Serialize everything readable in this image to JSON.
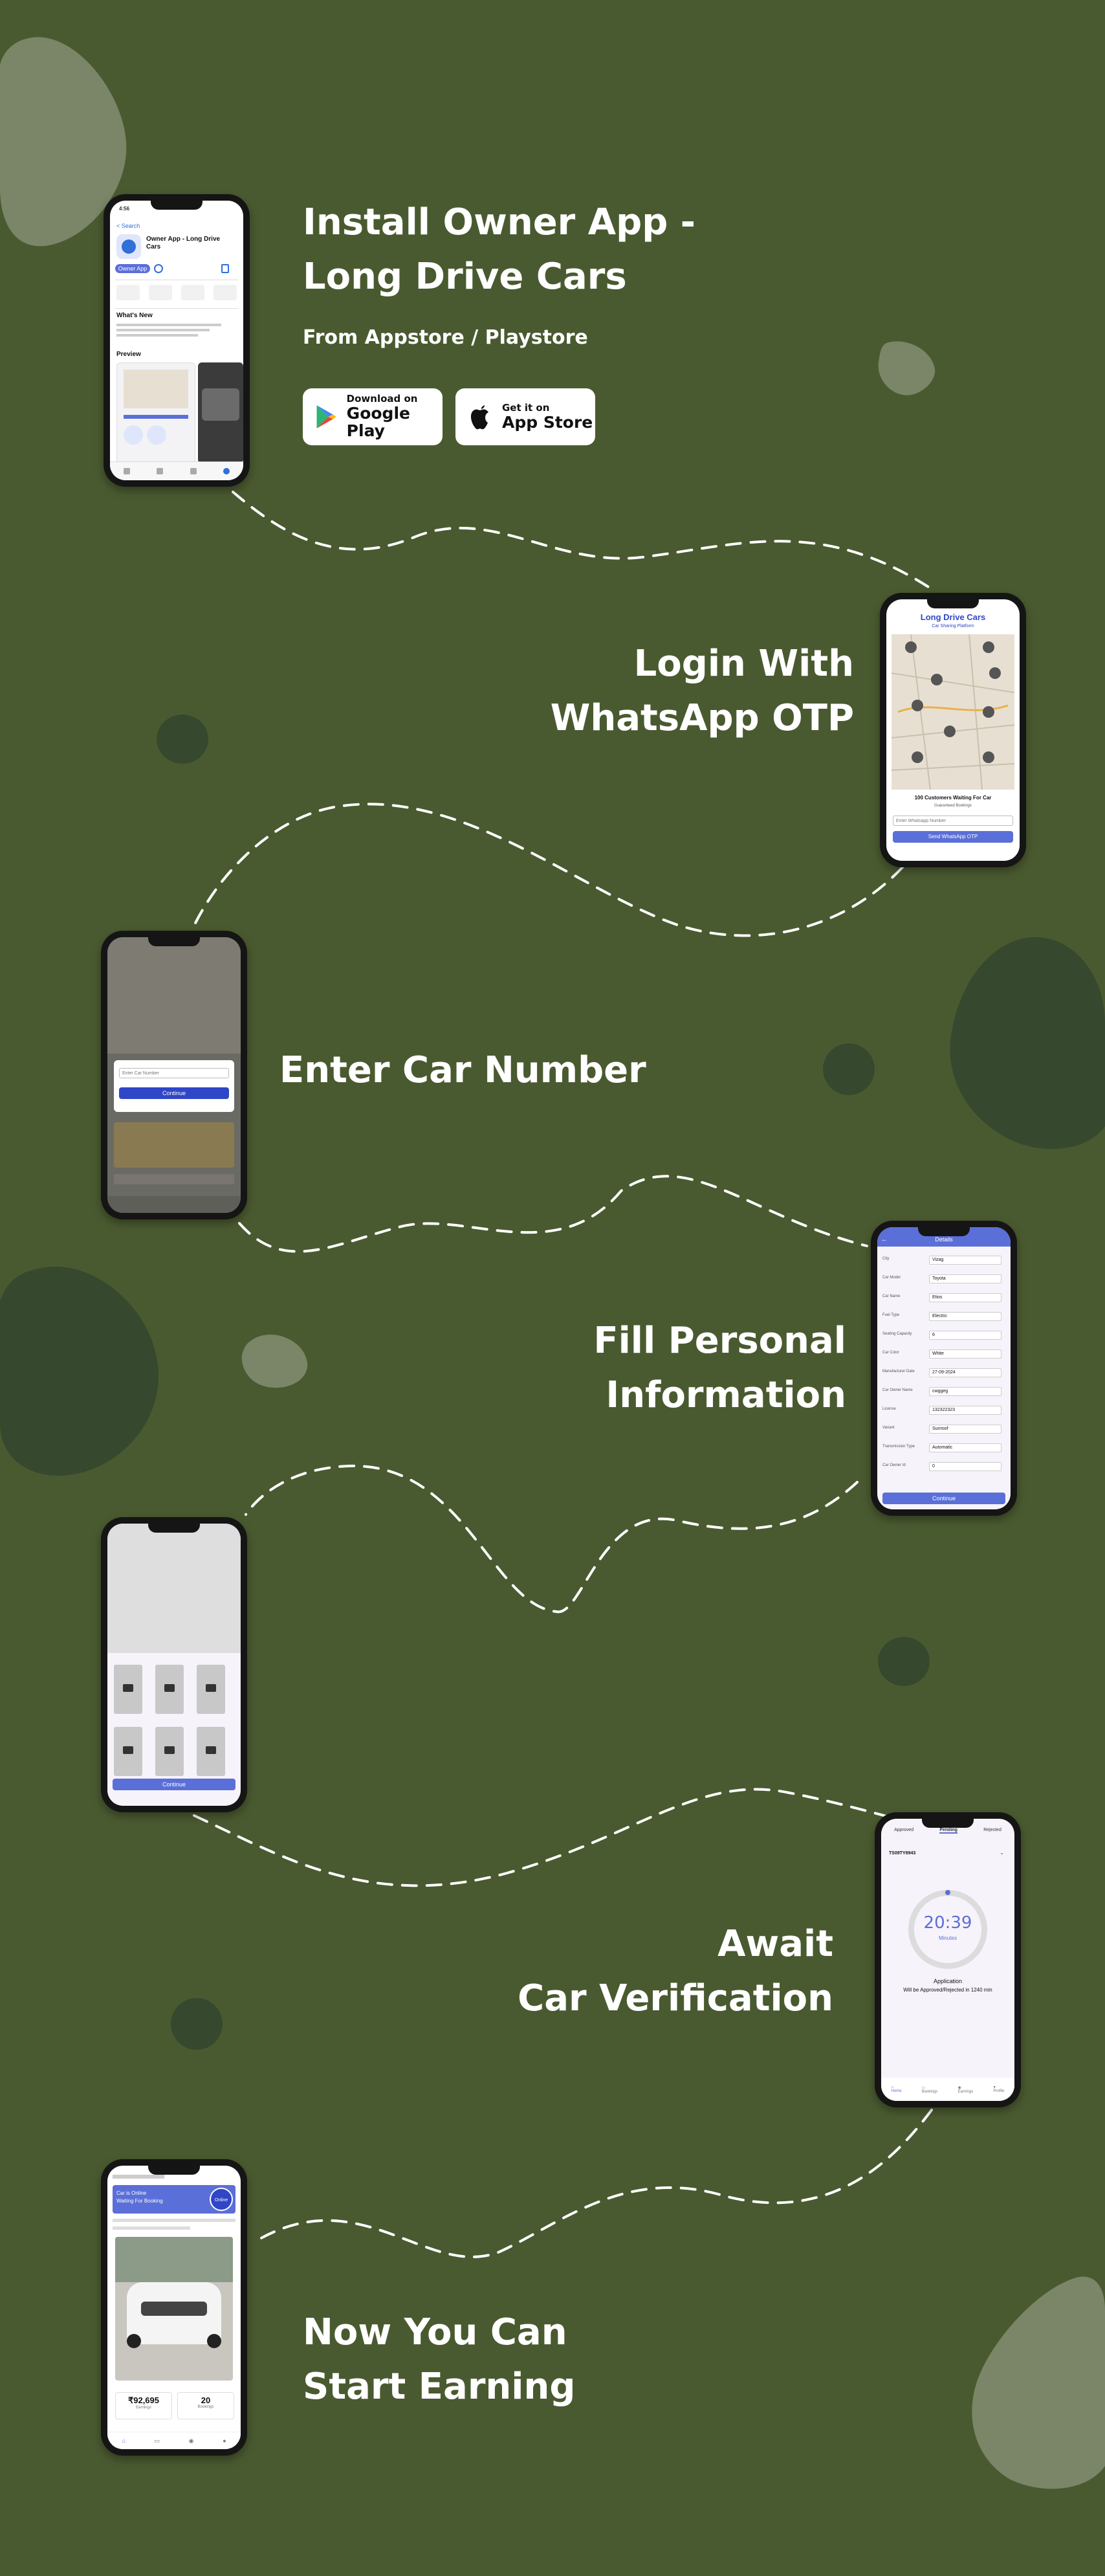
{
  "steps": [
    {
      "title_line1": "Install Owner App -",
      "title_line2": "Long Drive Cars",
      "subtitle": "From Appstore / Playstore"
    },
    {
      "title_line1": "Login With",
      "title_line2": "WhatsApp OTP"
    },
    {
      "title_line1": "Enter Car Number"
    },
    {
      "title_line1": "Fill Personal",
      "title_line2": "Information"
    },
    {
      "title_line1": "Await",
      "title_line2": "Car Verification"
    },
    {
      "title_line1": "Now You Can",
      "title_line2": "Start Earning"
    }
  ],
  "stores": {
    "google": {
      "line1": "Download  on",
      "line2": "Google Play"
    },
    "apple": {
      "line1": "Get it on",
      "line2": "App Store"
    }
  },
  "screen1": {
    "time": "4:56",
    "back": "< Search",
    "app_name": "Owner App - Long Drive Cars",
    "button": "Owner App",
    "whats_new": "What's New",
    "preview": "Preview"
  },
  "screen2": {
    "brand": "Long Drive Cars",
    "tagline": "Car Sharing Platform",
    "waiting": "100 Customers Waiting For Car",
    "bookings": "Guaranteed Bookings",
    "placeholder": "Enter Whatsapp Number",
    "button": "Send WhatsApp OTP"
  },
  "screen3": {
    "placeholder": "Enter Car Number",
    "button": "Continue"
  },
  "screen4": {
    "header": "Details",
    "fields": [
      {
        "label": "City",
        "value": "Vizag"
      },
      {
        "label": "Car Model",
        "value": "Toyota"
      },
      {
        "label": "Car Name",
        "value": "Etios"
      },
      {
        "label": "Fuel Type",
        "value": "Electric"
      },
      {
        "label": "Seating Capacity",
        "value": "6"
      },
      {
        "label": "Car Color",
        "value": "White"
      },
      {
        "label": "Manufacturer Date",
        "value": "27-09-2024"
      },
      {
        "label": "Car Owner Name",
        "value": "cwggeg"
      },
      {
        "label": "License",
        "value": "132322323"
      },
      {
        "label": "Variant",
        "value": "Sunroof"
      },
      {
        "label": "Transmission Type",
        "value": "Automatic"
      },
      {
        "label": "Car Owner Id",
        "value": "0"
      }
    ],
    "button": "Continue"
  },
  "screen5": {
    "button": "Continue"
  },
  "screen6": {
    "tabs": [
      "Approved",
      "Pending",
      "Rejected"
    ],
    "car_id": "TS09TY8943",
    "timer": "20:39",
    "unit": "Minutes",
    "label": "Application",
    "note": "Will be Approved/Rejected in 1240 min",
    "nav": [
      "Home",
      "Bookings",
      "Earnings",
      "Profile"
    ]
  },
  "screen7": {
    "banner_line1": "Car is Online",
    "banner_line2": "Waiting For Booking",
    "toggle": "Online",
    "earnings": "₹92,695",
    "earnings_label": "Earnings",
    "bookings": "20",
    "bookings_label": "Bookings"
  },
  "colors": {
    "background": "#4a5a30",
    "accent": "#5b6fd8",
    "blob_dark": "#36492f",
    "blob_light": "#7b8668"
  }
}
